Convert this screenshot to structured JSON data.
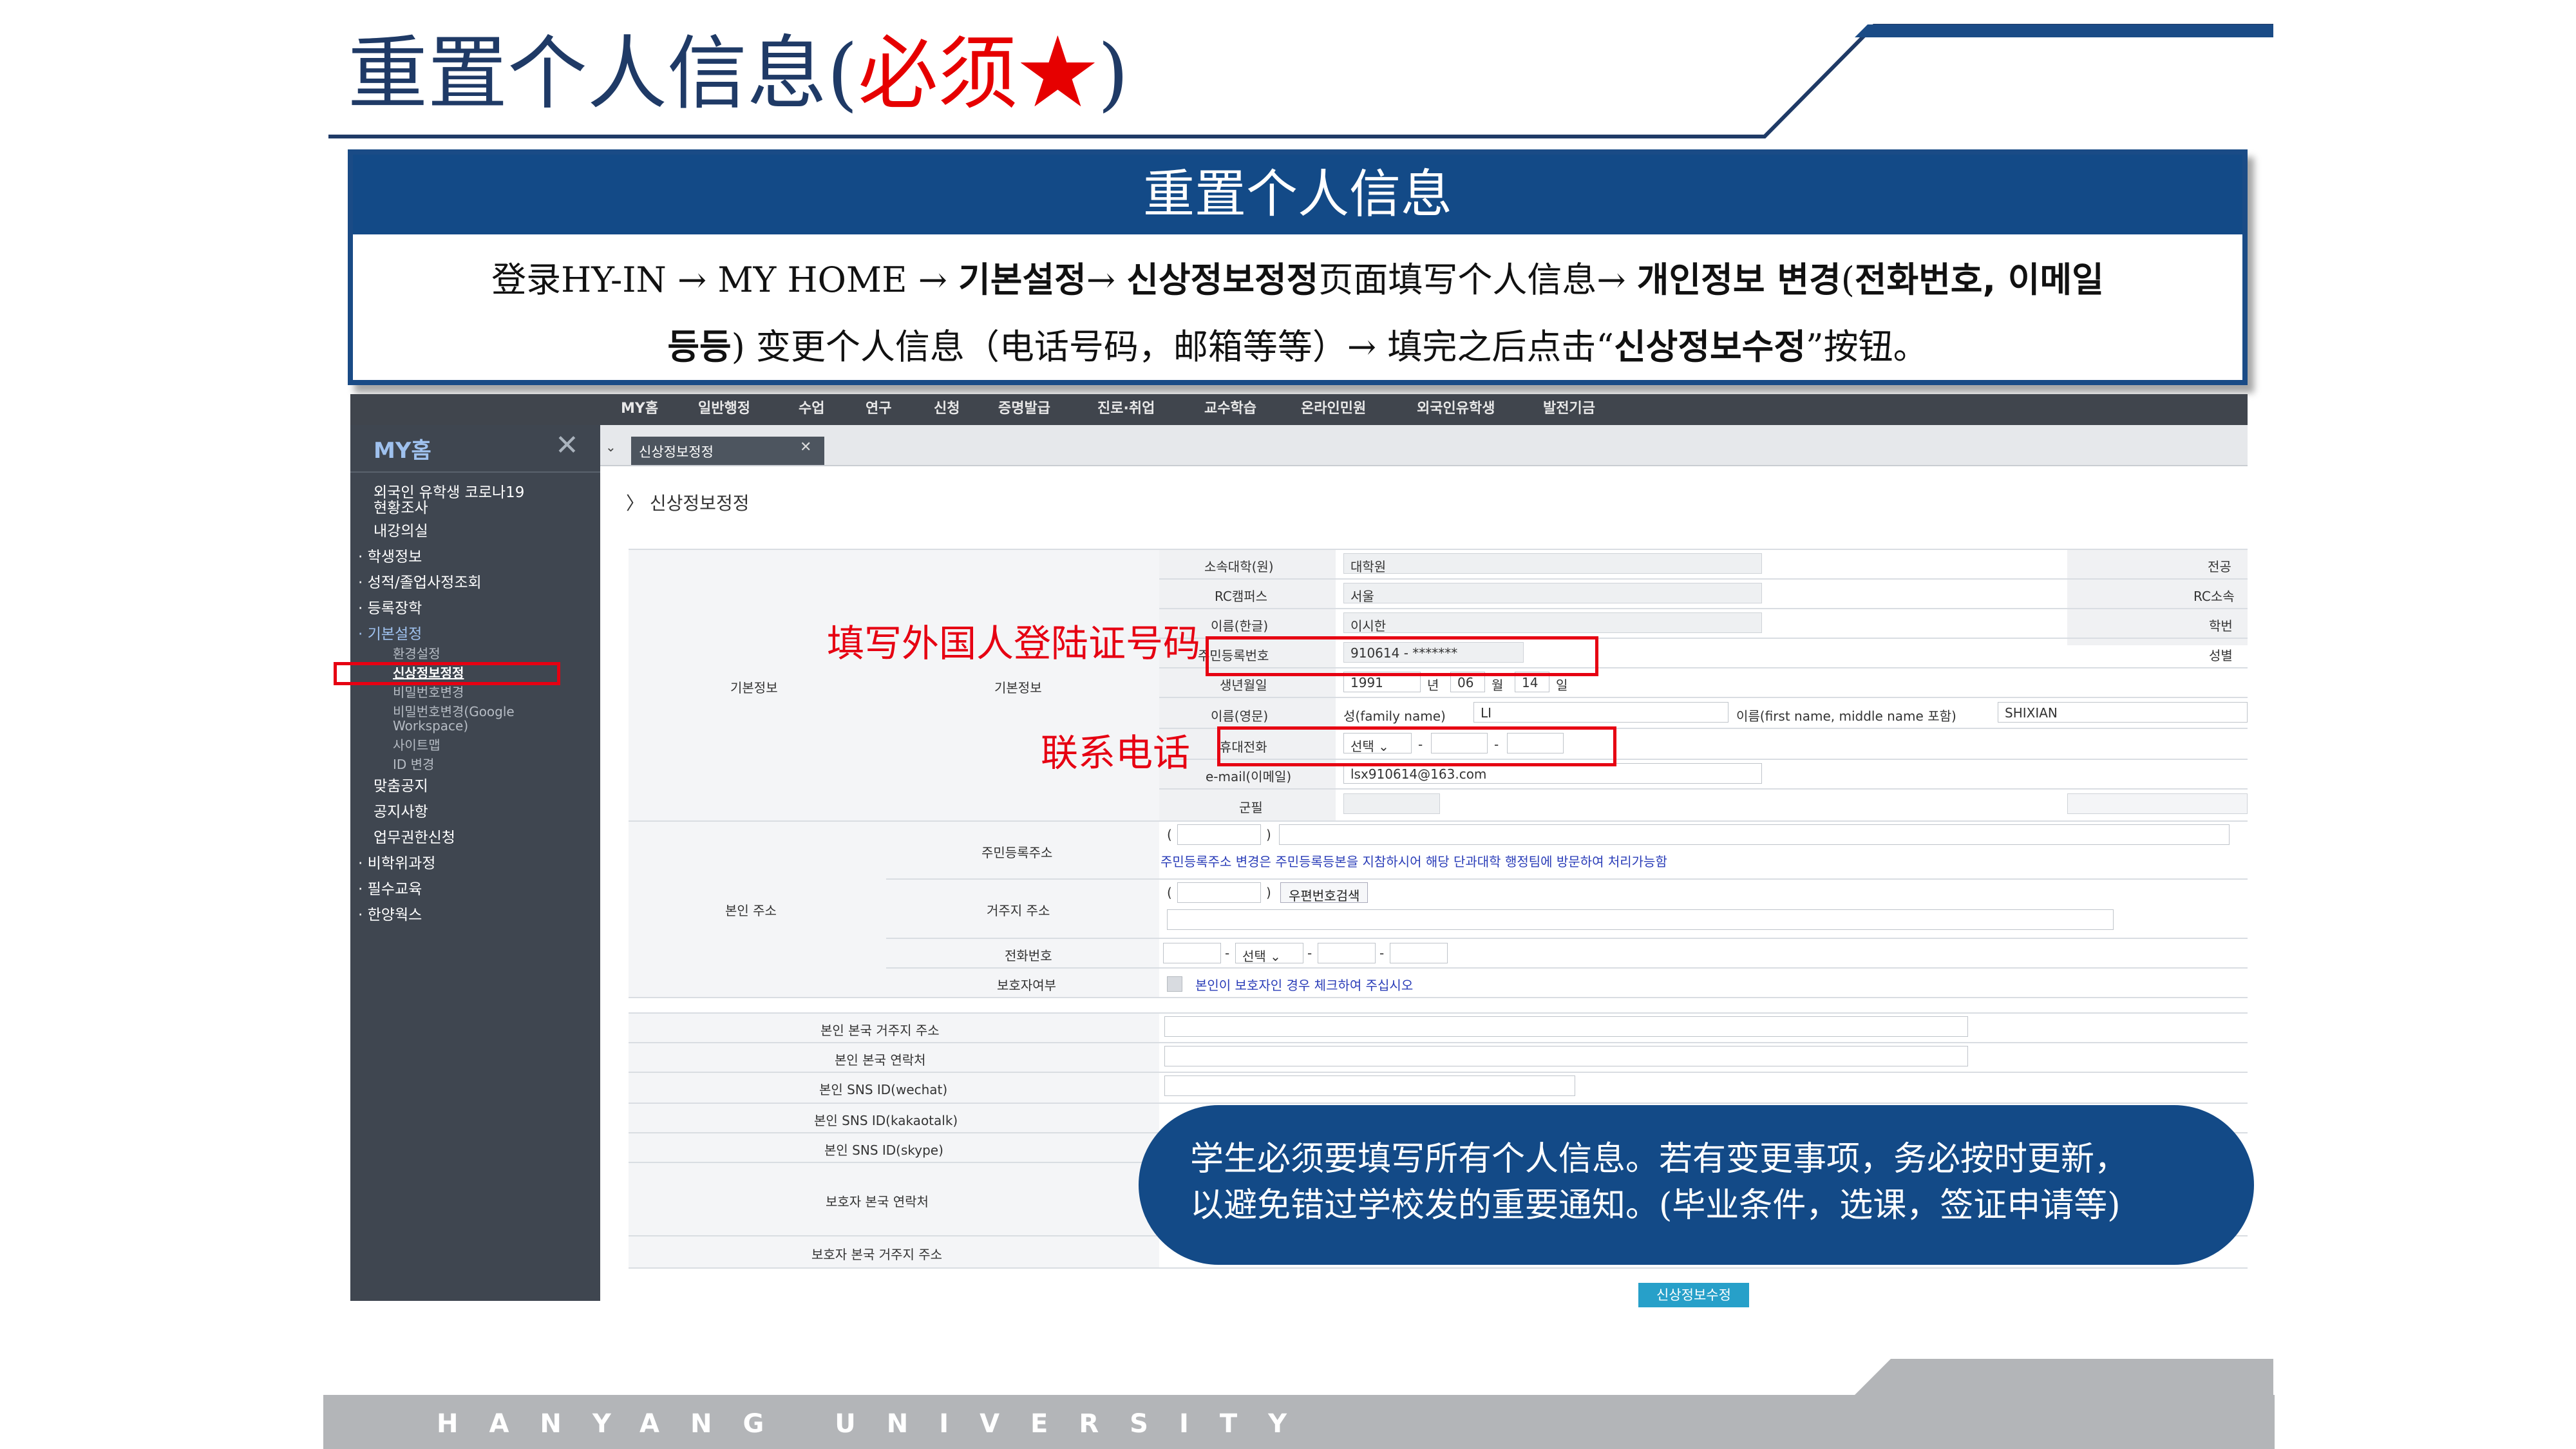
{
  "slide": {
    "title_main": "重置个人信息(",
    "title_req": "必须★",
    "title_end": ")",
    "footer": "HANYANG UNIVERSITY"
  },
  "instruction": {
    "header": "重置个人信息",
    "line1_a": "登录HY-IN → MY HOME → ",
    "line1_b": "기본설정",
    "line1_c": "→ ",
    "line1_d": "신상정보정정",
    "line1_e": "页面填写个人信息→ ",
    "line1_f": "개인정보 변경",
    "line1_g": "(",
    "line1_h": "전화번호, 이메일",
    "line2_a": "등등",
    "line2_b": ") 变更个人信息（电话号码，邮箱等等）→ 填完之后点击“",
    "line2_c": "신상정보수정",
    "line2_d": "”按钮。"
  },
  "top_nav": [
    "MY홈",
    "일반행정",
    "수업",
    "연구",
    "신청",
    "증명발급",
    "진로·취업",
    "교수학습",
    "온라인민원",
    "외국인유학생",
    "발전기금"
  ],
  "sidebar": {
    "title": "MY홈",
    "items": [
      {
        "label": "외국인 유학생 코로나19"
      },
      {
        "label": "현황조사"
      },
      {
        "label": "내강의실"
      },
      {
        "label": "· 학생정보"
      },
      {
        "label": "· 성적/졸업사정조회"
      },
      {
        "label": "· 등록장학"
      },
      {
        "label": "· 기본설정"
      }
    ],
    "sub_items": [
      {
        "label": "환경설정"
      },
      {
        "label": "신상정보정정"
      },
      {
        "label": "비밀번호변경"
      },
      {
        "label": "비밀번호변경(Google"
      },
      {
        "label": "Workspace)"
      },
      {
        "label": "사이트맵"
      },
      {
        "label": "ID 변경"
      }
    ],
    "items2": [
      {
        "label": "맞춤공지"
      },
      {
        "label": "공지사항"
      },
      {
        "label": "업무권한신청"
      },
      {
        "label": "· 비학위과정"
      },
      {
        "label": "· 필수교육"
      },
      {
        "label": "· 한양웍스"
      }
    ]
  },
  "tab": {
    "label": "신상정보정정",
    "close": "✕"
  },
  "page_heading": "〉 신상정보정정",
  "form": {
    "group_basic": "기본정보",
    "group_basic2": "기본정보",
    "rows": [
      {
        "label": "소속대학(원)",
        "value": "대학원",
        "right_label": "전공"
      },
      {
        "label": "RC캠퍼스",
        "value": "서울",
        "right_label": "RC소속"
      },
      {
        "label": "이름(한글)",
        "value": "이시한",
        "right_label": "학번"
      },
      {
        "label": "주민등록번호",
        "value": "910614 - *******",
        "right_label": "성별"
      }
    ],
    "birth": {
      "label": "생년월일",
      "year": "1991",
      "y_unit": "년",
      "month": "06",
      "m_unit": "월",
      "day": "14",
      "d_unit": "일"
    },
    "name_en": {
      "label": "이름(영문)",
      "family_label": "성(family name)",
      "family": "LI",
      "given_label": "이름(first name, middle name 포함)",
      "given": "SHIXIAN"
    },
    "mobile": {
      "label": "휴대전화",
      "select": "선택 ⌄",
      "dash1": "-",
      "dash2": "-"
    },
    "email": {
      "label": "e-mail(이메일)",
      "value": "lsx910614@163.com"
    },
    "military": {
      "label": "군필"
    },
    "group_addr": "본인 주소",
    "resident_addr_label": "주민등록주소",
    "resident_note": "주민등록주소 변경은 주민등록등본을 지참하시어 해당 단과대학 행정팀에 방문하여 처리가능함",
    "living_addr_label": "거주지 주소",
    "zip_btn": "우편번호검색",
    "phone_label": "전화번호",
    "phone_select": "선택 ⌄",
    "guardian_label": "보호자여부",
    "guardian_note": "본인이 보호자인 경우 체크하여 주십시오",
    "extra_rows": [
      {
        "label": "본인 본국 거주지 주소"
      },
      {
        "label": "본인 본국 연락처"
      },
      {
        "label": "본인 SNS ID(wechat)"
      },
      {
        "label": "본인 SNS ID(kakaotalk)"
      },
      {
        "label": "본인 SNS ID(skype)"
      },
      {
        "label": "보호자 본국 연락처"
      },
      {
        "label": "보호자 본국 거주지 주소"
      }
    ],
    "submit": "신상정보수정"
  },
  "annotations": {
    "alien_reg": "填写外国人登陆证号码",
    "phone": "联系电话",
    "callout_line1": "学生必须要填写所有个人信息。若有变更事项，务必按时更新，",
    "callout_line2": "以避免错过学校发的重要通知。(毕业条件，选课，签证申请等)"
  },
  "colors": {
    "brand_blue": "#134a87",
    "title_blue": "#1f3a66",
    "annotation_red": "#e60012",
    "sidebar_bg": "#3f4650"
  }
}
